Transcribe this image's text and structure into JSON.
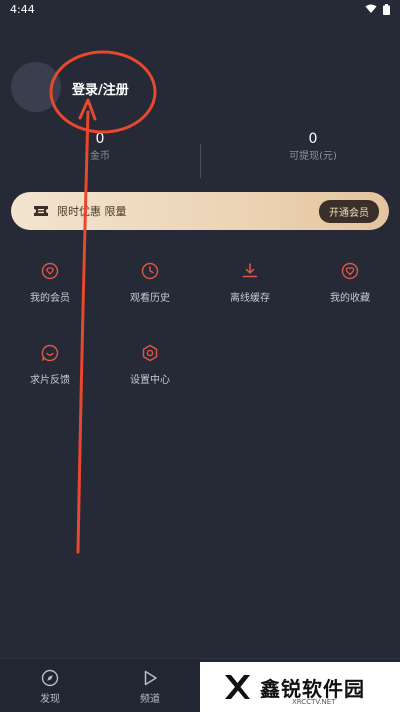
{
  "status_bar": {
    "time": "4:44",
    "wifi_icon": "wifi-icon",
    "battery_icon": "battery-icon"
  },
  "profile": {
    "login_label": "登录/注册",
    "avatar_icon": "avatar-placeholder"
  },
  "stats": {
    "coins": {
      "value": "0",
      "label": "金币"
    },
    "withdrawable": {
      "value": "0",
      "label": "可提现(元)"
    }
  },
  "vip_banner": {
    "icon": "ticket-icon",
    "promo_text": "限时优惠 限量",
    "button_label": "开通会员",
    "colors": {
      "start": "#f2e4cf",
      "end": "#e4c49e"
    }
  },
  "menu": [
    {
      "label": "我的会员",
      "icon": "diamond-icon"
    },
    {
      "label": "观看历史",
      "icon": "clock-icon"
    },
    {
      "label": "离线缓存",
      "icon": "download-icon"
    },
    {
      "label": "我的收藏",
      "icon": "heart-icon"
    },
    {
      "label": "求片反馈",
      "icon": "feedback-icon"
    },
    {
      "label": "设置中心",
      "icon": "settings-icon"
    }
  ],
  "bottom_nav": [
    {
      "label": "发现",
      "icon": "compass-icon"
    },
    {
      "label": "频道",
      "icon": "play-icon"
    }
  ],
  "watermark": {
    "brand": "鑫锐软件园",
    "sub": "XRCCTV.NET"
  },
  "colors": {
    "background": "#262a36",
    "accent": "#e0554a",
    "annotation": "#e8482f"
  }
}
